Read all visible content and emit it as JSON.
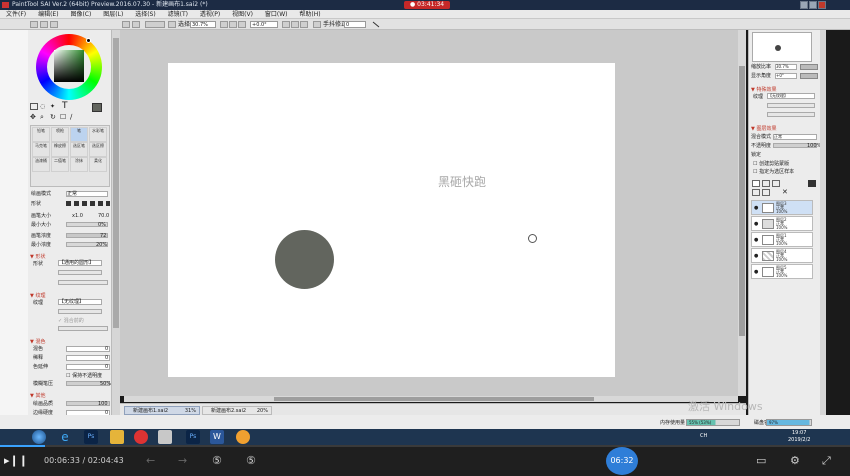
{
  "window": {
    "title": "PaintTool SAI Ver.2 (64bit) Preview.2016.07.30 - 新建画布1.sai2 (*)",
    "record_time": "03:41:34"
  },
  "menu": [
    "文件(F)",
    "编辑(E)",
    "图像(C)",
    "图层(L)",
    "选择(S)",
    "滤镜(T)",
    "透视(P)",
    "视图(V)",
    "窗口(W)",
    "帮助(H)"
  ],
  "toolbar": {
    "select_label": "选择",
    "zoom": "30.7%",
    "angle": "+0.0°",
    "stabilizer_label": "手抖修正",
    "stabilizer_value": "0"
  },
  "left_panel": {
    "blend_mode_label": "绘画模式",
    "blend_mode_value": "正常",
    "shape_label": "形状",
    "size_label": "画笔大小",
    "size_scale": "x1.0",
    "size_value": "70.0",
    "min_size_label": "最小大小",
    "min_size_value": "0%",
    "density_label": "画笔浓度",
    "density_value": "72",
    "min_density_label": "最小浓度",
    "min_density_value": "20%",
    "shape_section": "形状",
    "shape_select": "【通用的圆形】",
    "texture_section": "纹理",
    "texture_select": "【无纹理】",
    "texture_check": "混合前的",
    "blend_section": "混色",
    "blend_label": "混色",
    "blend_value": "0",
    "water_label": "稀释",
    "water_value": "0",
    "persistence_label": "色延伸",
    "persistence_value": "0",
    "keep_opacity": "保持不透明度",
    "blur_label": "模糊笔压",
    "blur_value": "50%",
    "other_section": "其他",
    "quality_label": "绘画品质",
    "quality_value": "100",
    "edge_label": "边缘硬度",
    "edge_value": "0",
    "tools": [
      {
        "name": "铅笔",
        "sub": ""
      },
      {
        "name": "喷枪",
        "sub": ""
      },
      {
        "name": "笔",
        "sub": ""
      },
      {
        "name": "水彩笔",
        "sub": ""
      },
      {
        "name": "马克笔",
        "sub": ""
      },
      {
        "name": "橡皮擦",
        "sub": ""
      },
      {
        "name": "选区笔",
        "sub": ""
      },
      {
        "name": "选区擦",
        "sub": ""
      },
      {
        "name": "油漆桶",
        "sub": ""
      },
      {
        "name": "二值笔",
        "sub": ""
      },
      {
        "name": "涂抹",
        "sub": ""
      },
      {
        "name": "柔化",
        "sub": ""
      }
    ]
  },
  "canvas": {
    "watermark_text": "黑砸快跑",
    "circle_color": "#62655e",
    "paper_color": "#ffffff"
  },
  "doc_tabs": [
    {
      "label": "新建画布1.sai2",
      "zoom": "31%"
    },
    {
      "label": "新建画布2.sai2",
      "zoom": "20%"
    }
  ],
  "right_panel": {
    "nav_zoom_label": "缩放比率",
    "nav_zoom_value": "30.7%",
    "nav_angle_label": "显示角度",
    "nav_angle_value": "+0°",
    "effects_section": "特殊效果",
    "texture_label": "纹理",
    "texture_value": "【无纹理】",
    "layer_section": "图层效果",
    "blend_label": "混合模式",
    "blend_value": "正常",
    "opacity_label": "不透明度",
    "opacity_value": "100%",
    "lock_label": "锁定",
    "clip_label": "创建剪贴蒙版",
    "ref_label": "指定为选区样本",
    "layers": [
      {
        "name": "图层3",
        "mode": "正常",
        "opacity": "100%",
        "selected": true
      },
      {
        "name": "图层2",
        "mode": "正常",
        "opacity": "100%",
        "selected": false
      },
      {
        "name": "图层1",
        "mode": "正常",
        "opacity": "100%",
        "selected": false
      },
      {
        "name": "图层4",
        "mode": "正常",
        "opacity": "100%",
        "selected": false
      },
      {
        "name": "图层5",
        "mode": "正常",
        "opacity": "100%",
        "selected": false
      }
    ]
  },
  "status": {
    "memory_label": "内存使用量",
    "memory_value": "55% (53%)",
    "disk_label": "磁盘容量",
    "disk_value": "97%",
    "windows_activate": "激活 Windows"
  },
  "taskbar": {
    "time": "19:07",
    "date": "2019/2/2",
    "lang": "CH"
  },
  "player": {
    "current": "00:06:33",
    "separator": "/",
    "total": "02:04:43",
    "bubble": "06:32",
    "progress": 0.053
  },
  "colors": {
    "accent": "#2f7ed8",
    "workspace": "#c9c9c9",
    "titlebar": "#1c2b44"
  }
}
